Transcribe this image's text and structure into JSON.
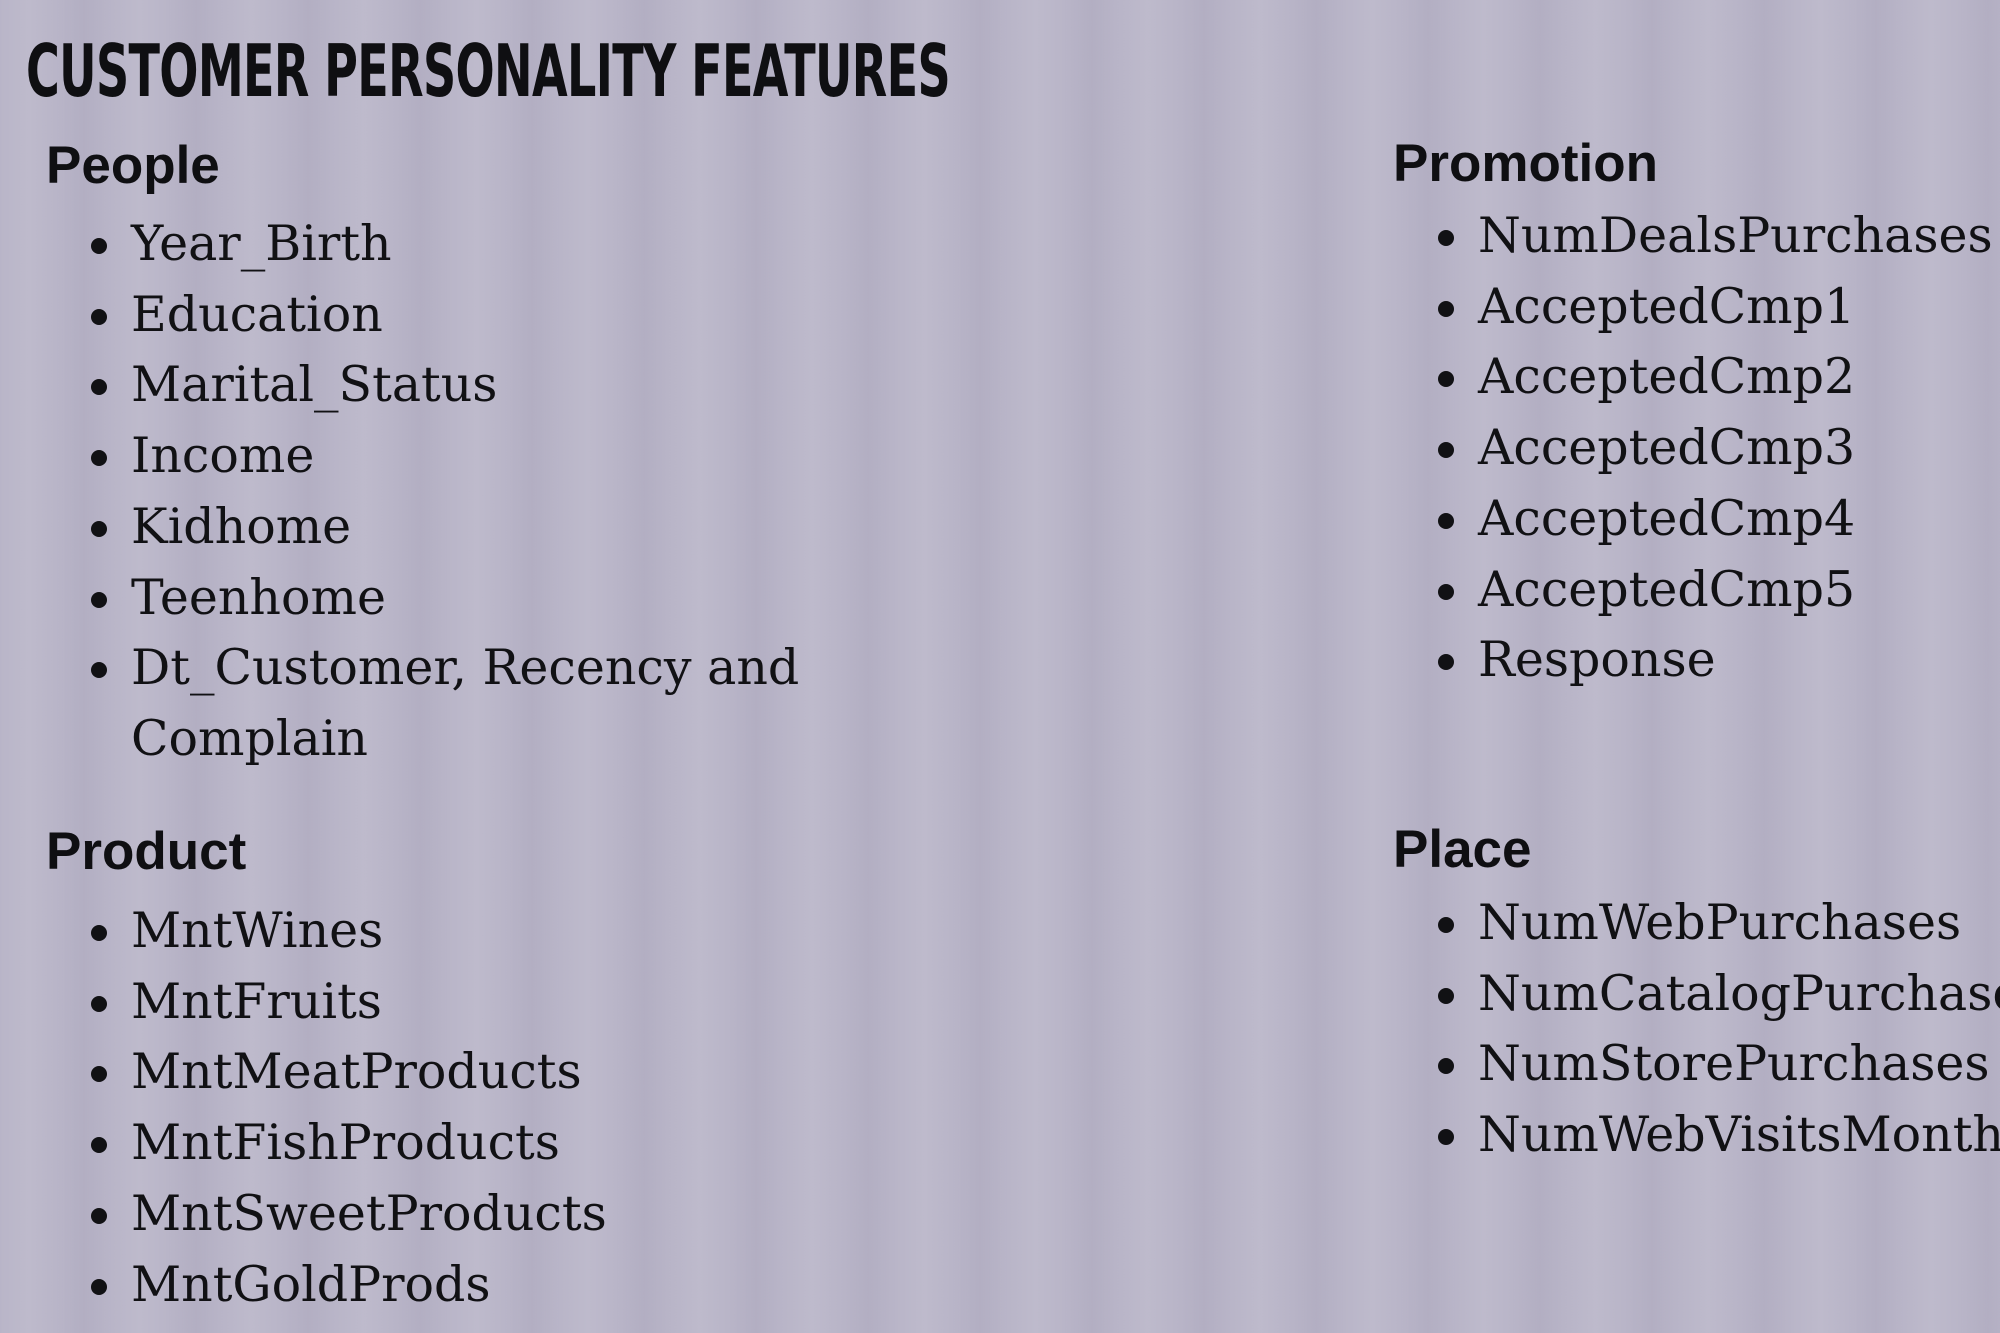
{
  "title": "CUSTOMER PERSONALITY FEATURES",
  "sections": {
    "people": {
      "heading": "People",
      "items": [
        "Year_Birth",
        "Education",
        "Marital_Status",
        "Income",
        "Kidhome",
        "Teenhome",
        "Dt_Customer, Recency and",
        "Complain"
      ]
    },
    "product": {
      "heading": "Product",
      "items": [
        "MntWines",
        "MntFruits",
        "MntMeatProducts",
        "MntFishProducts",
        "MntSweetProducts",
        "MntGoldProds"
      ]
    },
    "promotion": {
      "heading": "Promotion",
      "items": [
        "NumDealsPurchases",
        "AcceptedCmp1",
        "AcceptedCmp2",
        "AcceptedCmp3",
        "AcceptedCmp4",
        "AcceptedCmp5",
        "Response"
      ]
    },
    "place": {
      "heading": "Place",
      "items": [
        "NumWebPurchases",
        "NumCatalogPurchases",
        "NumStorePurchases",
        "NumWebVisitsMonth"
      ]
    }
  }
}
